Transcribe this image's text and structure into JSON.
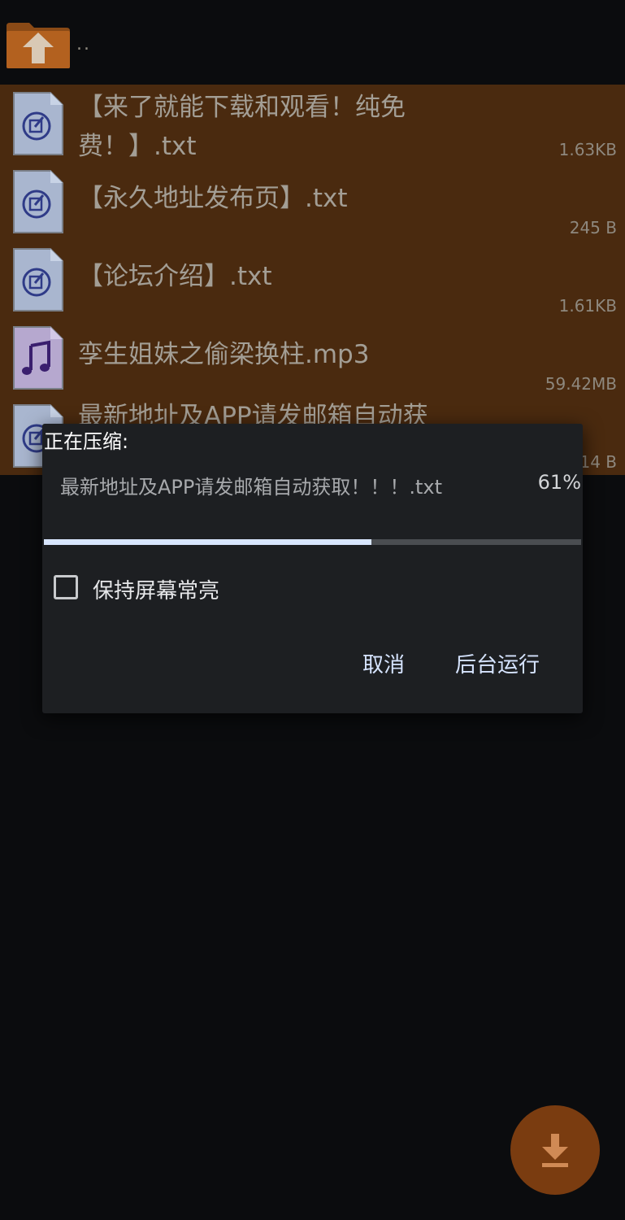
{
  "parent": {
    "label": "..",
    "icon": "up-folder-icon"
  },
  "files": [
    {
      "name": "【来了就能下载和观看！纯免费！】.txt",
      "size": "1.63KB",
      "icon": "text-file-icon"
    },
    {
      "name": "【永久地址发布页】.txt",
      "size": "245 B",
      "icon": "text-file-icon"
    },
    {
      "name": "【论坛介绍】.txt",
      "size": "1.61KB",
      "icon": "text-file-icon"
    },
    {
      "name": "孪生姐妹之偷梁换柱.mp3",
      "size": "59.42MB",
      "icon": "music-file-icon"
    },
    {
      "name": "最新地址及APP请发邮箱自动获",
      "size": "14 B",
      "icon": "text-file-icon"
    }
  ],
  "dialog": {
    "title": "正在压缩:",
    "current_file": "最新地址及APP请发邮箱自动获取！！！.txt",
    "percent_label": "61%",
    "progress": 0.61,
    "keep_screen_label": "保持屏幕常亮",
    "keep_screen_checked": false,
    "cancel_label": "取消",
    "background_label": "后台运行"
  },
  "fab": {
    "icon": "download-icon"
  },
  "colors": {
    "list_bg": "#4a2a0f",
    "dialog_bg": "#1d1f22",
    "accent": "#d8e6ff",
    "fab": "#7a3c10"
  }
}
